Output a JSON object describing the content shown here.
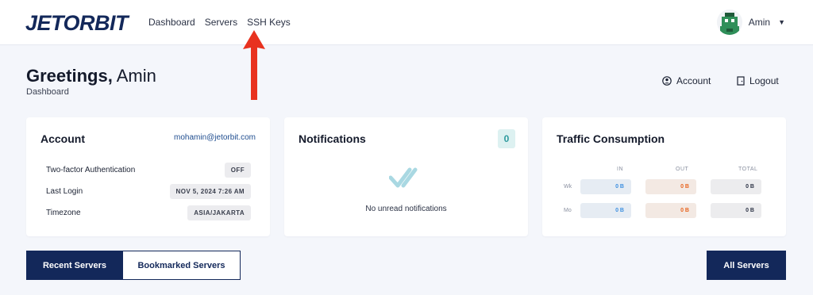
{
  "brand": {
    "name": "JETORBIT",
    "accent": "#13285a"
  },
  "nav": {
    "items": [
      "Dashboard",
      "Servers",
      "SSH Keys"
    ]
  },
  "user": {
    "name": "Amin"
  },
  "header": {
    "greeting": "Greetings,",
    "name": "Amin",
    "breadcrumb": "Dashboard",
    "account_link": "Account",
    "logout_link": "Logout"
  },
  "account": {
    "title": "Account",
    "email": "mohamin@jetorbit.com",
    "rows": [
      {
        "label": "Two-factor Authentication",
        "value": "OFF"
      },
      {
        "label": "Last Login",
        "value": "NOV 5, 2024 7:26 AM"
      },
      {
        "label": "Timezone",
        "value": "ASIA/JAKARTA"
      }
    ]
  },
  "notifications": {
    "title": "Notifications",
    "count": "0",
    "empty_text": "No unread notifications"
  },
  "traffic": {
    "title": "Traffic Consumption",
    "columns": [
      "IN",
      "OUT",
      "TOTAL"
    ],
    "rows": [
      {
        "label": "Wk",
        "in": "0 B",
        "out": "0 B",
        "total": "0 B"
      },
      {
        "label": "Mo",
        "in": "0 B",
        "out": "0 B",
        "total": "0 B"
      }
    ]
  },
  "buttons": {
    "recent": "Recent Servers",
    "bookmarked": "Bookmarked Servers",
    "all": "All Servers"
  },
  "annotation": {
    "arrow_color": "#e8321f"
  }
}
